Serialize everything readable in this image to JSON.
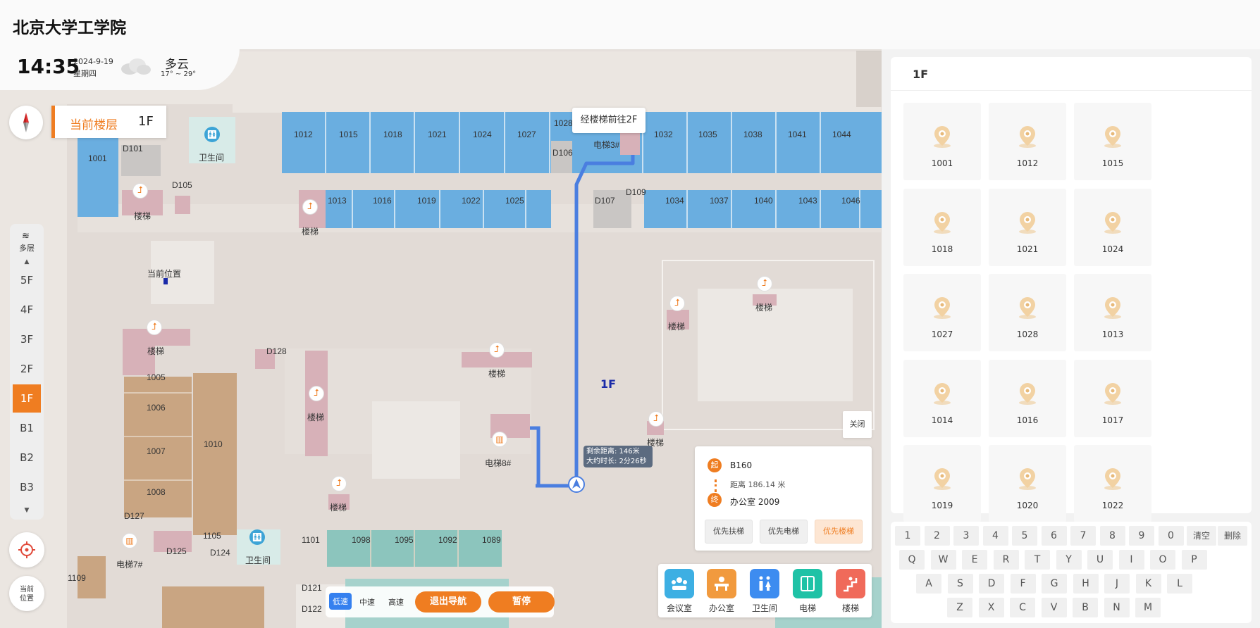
{
  "app": {
    "title": "北京大学工学院"
  },
  "status": {
    "time": "14:35",
    "date": "2024-9-19",
    "weekday": "星期四",
    "weather": "多云",
    "temperature": "17° ~ 29°"
  },
  "current_floor": {
    "label": "当前楼层",
    "value": "1F"
  },
  "floor_selector": {
    "label": "多层",
    "floors": [
      "5F",
      "4F",
      "3F",
      "2F",
      "1F",
      "B1",
      "B2",
      "B3"
    ],
    "active": "1F"
  },
  "controls": {
    "locate": "",
    "current_position": "当前位置"
  },
  "map": {
    "floor_label": "1F",
    "tooltip": "经楼梯前往2F",
    "current_position_label": "当前位置",
    "remaining": "剩余距离: 146米",
    "eta": "大约时长: 2分26秒",
    "rooms_top": [
      "1012",
      "1015",
      "1018",
      "1021",
      "1024",
      "1027",
      "1028",
      "1032",
      "1035",
      "1038",
      "1041",
      "1044"
    ],
    "rooms_second": [
      "1013",
      "1016",
      "1019",
      "1022",
      "1025",
      "1034",
      "1037",
      "1040",
      "1043",
      "1046"
    ],
    "rooms_misc": [
      "1001",
      "D101",
      "D105",
      "D106",
      "D107",
      "D109",
      "D128",
      "1005",
      "1006",
      "1007",
      "1008",
      "1010",
      "D127",
      "D125",
      "D124",
      "1105",
      "1109",
      "1101",
      "1098",
      "1095",
      "1092",
      "1089",
      "D121",
      "D122"
    ],
    "labels": {
      "restroom": "卫生间",
      "stairs": "楼梯",
      "elevator3": "电梯3#",
      "elevator8": "电梯8#",
      "elevator7": "电梯7#",
      "meeting": "会议室"
    }
  },
  "navigation": {
    "speeds": [
      "低速",
      "中速",
      "高速"
    ],
    "active_speed": "低速",
    "exit": "退出导航",
    "pause": "暂停"
  },
  "route": {
    "close": "关闭",
    "start_tag": "起",
    "start": "B160",
    "distance": "距离 186.14 米",
    "end_tag": "终",
    "end": "办公室 2009",
    "preferences": [
      "优先扶梯",
      "优先电梯",
      "优先楼梯"
    ],
    "active_preference": "优先楼梯"
  },
  "categories": [
    {
      "label": "会议室",
      "color": "#3dafe3",
      "icon": "meeting-icon"
    },
    {
      "label": "办公室",
      "color": "#f19a3e",
      "icon": "office-icon"
    },
    {
      "label": "卫生间",
      "color": "#3d8cf0",
      "icon": "restroom-icon"
    },
    {
      "label": "电梯",
      "color": "#1fc2a6",
      "icon": "elevator-icon"
    },
    {
      "label": "楼梯",
      "color": "#f06a5a",
      "icon": "stairs-icon"
    }
  ],
  "panel": {
    "floor": "1F",
    "rooms": [
      "1001",
      "1012",
      "1015",
      "1018",
      "1021",
      "1024",
      "1027",
      "1028",
      "1013",
      "1014",
      "1016",
      "1017",
      "1019",
      "1020",
      "1022"
    ]
  },
  "keyboard": {
    "row1": [
      "1",
      "2",
      "3",
      "4",
      "5",
      "6",
      "7",
      "8",
      "9",
      "0"
    ],
    "row1_actions": [
      "清空",
      "删除"
    ],
    "row2": [
      "Q",
      "W",
      "E",
      "R",
      "T",
      "Y",
      "U",
      "I",
      "O",
      "P"
    ],
    "row3": [
      "A",
      "S",
      "D",
      "F",
      "G",
      "H",
      "J",
      "K",
      "L"
    ],
    "row4": [
      "Z",
      "X",
      "C",
      "V",
      "B",
      "N",
      "M"
    ]
  },
  "colors": {
    "accent": "#ef7d21",
    "room_blue": "#6aaee0",
    "room_tan": "#c9a582",
    "room_pink": "#d7b1b8",
    "room_teal": "#8cc5bd",
    "route": "#4a7ee0"
  }
}
